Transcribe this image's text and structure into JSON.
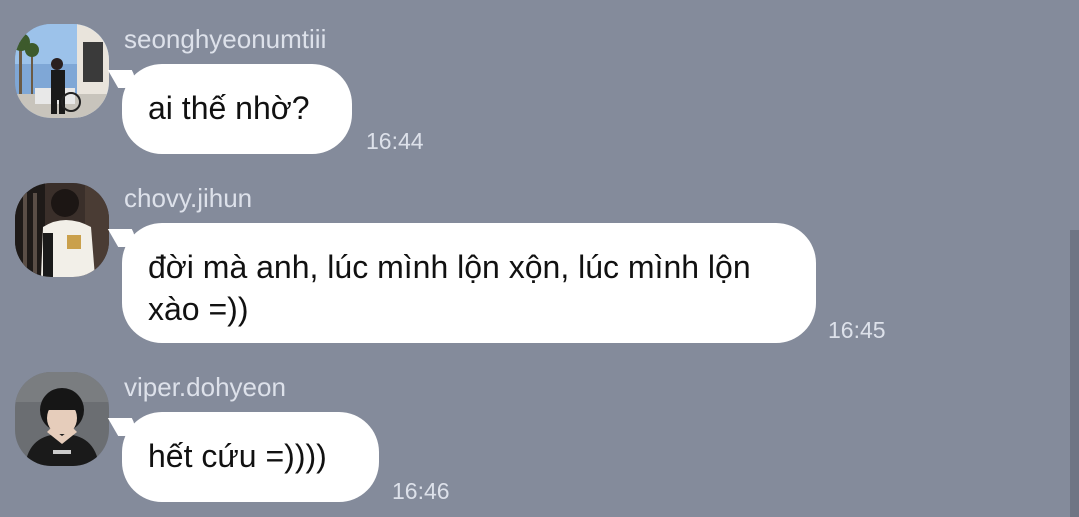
{
  "messages": [
    {
      "username": "seonghyeonumtiii",
      "text": "ai thế nhờ?",
      "time": "16:44"
    },
    {
      "username": "chovy.jihun",
      "text": "đời mà anh, lúc mình lộn xộn, lúc mình lộn xào =))",
      "time": "16:45"
    },
    {
      "username": "viper.dohyeon",
      "text": "hết cứu =))))",
      "time": "16:46"
    }
  ],
  "colors": {
    "background": "#848b9b",
    "bubble": "#ffffff",
    "meta_text": "#dde1ea"
  }
}
